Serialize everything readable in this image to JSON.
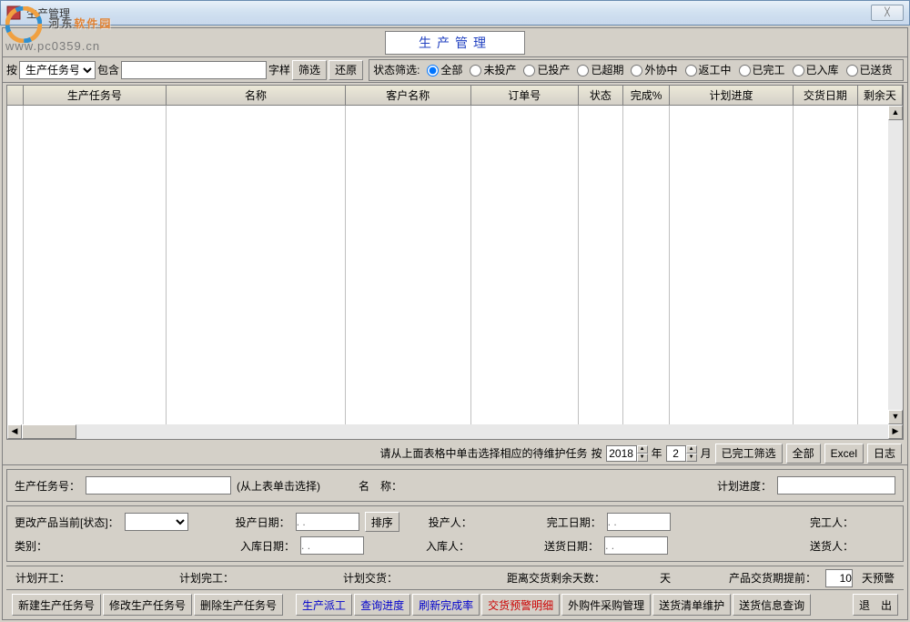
{
  "window": {
    "title": "生产管理",
    "close": "✕"
  },
  "watermark": {
    "brand_a": "河东",
    "brand_b": "软件园",
    "url": "www.pc0359.cn"
  },
  "header": {
    "title": "生产管理"
  },
  "filter": {
    "by_label": "按",
    "field_options": [
      "生产任务号"
    ],
    "selected_field": "生产任务号",
    "contains_label": "包含",
    "sample_label": "字样",
    "filter_btn": "筛选",
    "restore_btn": "还原",
    "status_legend": "状态筛选:",
    "radios": [
      "全部",
      "未投产",
      "已投产",
      "已超期",
      "外协中",
      "返工中",
      "已完工",
      "已入库",
      "已送货"
    ],
    "selected_radio": 0
  },
  "grid": {
    "columns": [
      "",
      "生产任务号",
      "名称",
      "客户名称",
      "订单号",
      "状态",
      "完成%",
      "计划进度",
      "交货日期",
      "剩余天"
    ]
  },
  "mid": {
    "hint": "请从上面表格中单击选择相应的待维护任务",
    "by": "按",
    "year_val": "2018",
    "year_unit": "年",
    "month_val": "2",
    "month_unit": "月",
    "done_filter": "已完工筛选",
    "all_btn": "全部",
    "excel_btn": "Excel",
    "log_btn": "日志"
  },
  "detail": {
    "task_no": "生产任务号：",
    "pick_hint": "(从上表单击选择)",
    "name_lbl": "名　称：",
    "plan_prog": "计划进度：",
    "status_lbl": "更改产品当前[状态]：",
    "start_date": "投产日期：",
    "date_ph": ". .",
    "sort_btn": "排序",
    "starter": "投产人：",
    "done_date": "完工日期：",
    "doner": "完工人：",
    "category": "类别：",
    "in_date": "入库日期：",
    "inner": "入库人：",
    "ship_date": "送货日期：",
    "shipper": "送货人："
  },
  "plan": {
    "plan_start": "计划开工：",
    "plan_done": "计划完工：",
    "plan_ship": "计划交货：",
    "remain_lbl": "距离交货剩余天数：",
    "remain_unit": "天",
    "warn_lbl": "产品交货期提前：",
    "warn_val": "10",
    "warn_unit": "天预警"
  },
  "buttons": {
    "new_task": "新建生产任务号",
    "edit_task": "修改生产任务号",
    "del_task": "删除生产任务号",
    "dispatch": "生产派工",
    "query_prog": "查询进度",
    "refresh": "刷新完成率",
    "warn_detail": "交货预警明细",
    "purchase": "外购件采购管理",
    "ship_list": "送货清单维护",
    "ship_query": "送货信息查询",
    "exit": "退　出"
  }
}
